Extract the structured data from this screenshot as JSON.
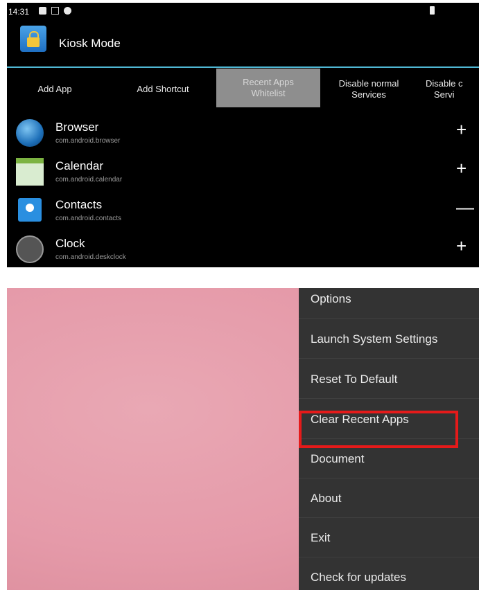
{
  "status_bar": {
    "time": "14:31"
  },
  "app_bar": {
    "title": "Kiosk Mode",
    "icon": "lock-icon"
  },
  "tabs": [
    {
      "label": "Add App",
      "active": false
    },
    {
      "label": "Add Shortcut",
      "active": false
    },
    {
      "label": "Recent Apps\nWhitelist",
      "active": true
    },
    {
      "label": "Disable normal\nServices",
      "active": false
    },
    {
      "label": "Disable c\nServi",
      "active": false
    }
  ],
  "apps": [
    {
      "name": "Browser",
      "package": "com.android.browser",
      "action": "+",
      "icon": "globe-icon"
    },
    {
      "name": "Calendar",
      "package": "com.android.calendar",
      "action": "+",
      "icon": "calendar-icon"
    },
    {
      "name": "Contacts",
      "package": "com.android.contacts",
      "action": "—",
      "icon": "contacts-icon"
    },
    {
      "name": "Clock",
      "package": "com.android.deskclock",
      "action": "+",
      "icon": "clock-icon"
    }
  ],
  "options_menu": {
    "items": [
      "Options",
      "Launch System Settings",
      "Reset To Default",
      "Clear Recent Apps",
      "Document",
      "About",
      "Exit",
      "Check for updates"
    ],
    "highlighted": "Clear Recent Apps"
  },
  "colors": {
    "accent_divider": "#4fb7d4",
    "highlight_box": "#e51a1a",
    "menu_background": "#333333",
    "wallpaper": "#e59aa9"
  }
}
